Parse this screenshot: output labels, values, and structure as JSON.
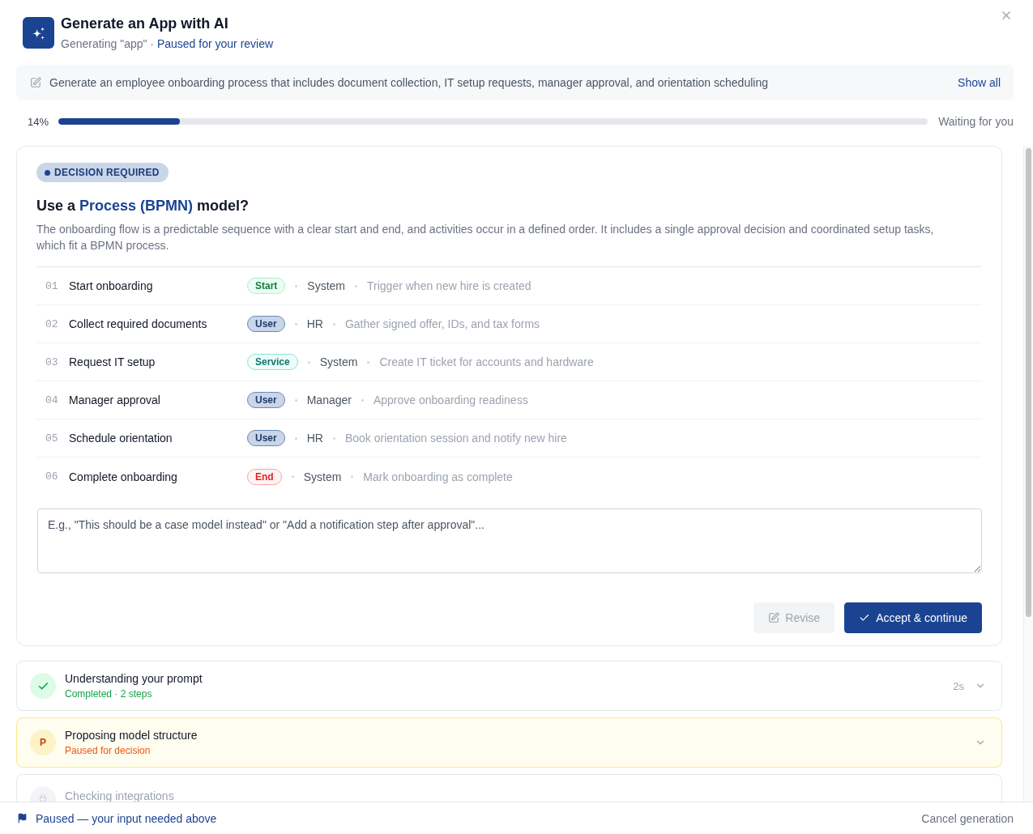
{
  "header": {
    "title": "Generate an App with AI",
    "subtitle": "Generating \"app\" ·",
    "status": "Paused for your review"
  },
  "prompt": {
    "text": "Generate an employee onboarding process that includes document collection, IT setup requests, manager approval, and orientation scheduling",
    "action": "Show all"
  },
  "progress": {
    "percent": "14%",
    "level": 0.14,
    "status": "Waiting for you"
  },
  "decision": {
    "badge": "DECISION REQUIRED",
    "heading": {
      "before": "Use a ",
      "highlight": "Process (BPMN)",
      "after": " model?"
    },
    "description": "The onboarding flow is a predictable sequence with a clear start and end, and activities occur in a defined order. It includes a single approval decision and coordinated setup tasks, which fit a BPMN process.",
    "steps": [
      {
        "number": "01",
        "name": "Start onboarding",
        "kind": "start",
        "tag": "Start",
        "actor": "System",
        "detail": "Trigger when new hire is created"
      },
      {
        "number": "02",
        "name": "Collect required documents",
        "kind": "user",
        "tag": "User",
        "actor": "HR",
        "detail": "Gather signed offer, IDs, and tax forms"
      },
      {
        "number": "03",
        "name": "Request IT setup",
        "kind": "service",
        "tag": "Service",
        "actor": "System",
        "detail": "Create IT ticket for accounts and hardware"
      },
      {
        "number": "04",
        "name": "Manager approval",
        "kind": "user",
        "tag": "User",
        "actor": "Manager",
        "detail": "Approve onboarding readiness"
      },
      {
        "number": "05",
        "name": "Schedule orientation",
        "kind": "user",
        "tag": "User",
        "actor": "HR",
        "detail": "Book orientation session and notify new hire"
      },
      {
        "number": "06",
        "name": "Complete onboarding",
        "kind": "end",
        "tag": "End",
        "actor": "System",
        "detail": "Mark onboarding as complete"
      }
    ],
    "feedback": {
      "placeholder": "E.g., \"This should be a case model instead\" or \"Add a notification step after approval\"..."
    },
    "buttons": [
      {
        "label": "Revise",
        "kind": "secondary",
        "disabled": true
      },
      {
        "label": "Accept & continue",
        "kind": "primary",
        "disabled": false
      }
    ]
  },
  "stages": [
    {
      "kind": "completed",
      "title": "Understanding your prompt",
      "subtitle": "Completed · 2 steps",
      "duration": "2s"
    },
    {
      "kind": "paused",
      "initial": "P",
      "title": "Proposing model structure",
      "subtitle": "Paused for decision"
    },
    {
      "kind": "pending",
      "title": "Checking integrations"
    }
  ],
  "footer": {
    "message": "Paused — your input needed above",
    "action": "Cancel generation"
  }
}
